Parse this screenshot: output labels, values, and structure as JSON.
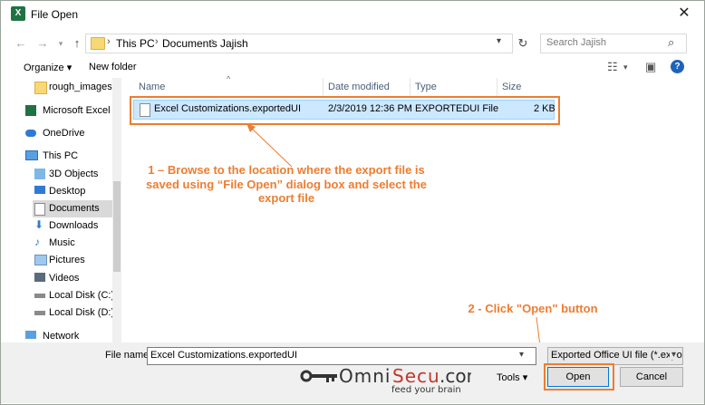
{
  "window": {
    "title": "File Open",
    "app_icon_letter": "X"
  },
  "address": {
    "crumbs": [
      "This PC",
      "Documents",
      "Jajish"
    ]
  },
  "search": {
    "placeholder": "Search Jajish"
  },
  "toolbar": {
    "organize": "Organize ▾",
    "new_folder": "New folder"
  },
  "sidebar": {
    "items": [
      {
        "label": "rough_images",
        "icon": "folder-icon"
      },
      {
        "label": "Microsoft Excel",
        "icon": "excel-icon"
      },
      {
        "label": "OneDrive",
        "icon": "cloud-icon"
      },
      {
        "label": "This PC",
        "icon": "computer-icon"
      },
      {
        "label": "3D Objects",
        "icon": "3d-objects-icon"
      },
      {
        "label": "Desktop",
        "icon": "desktop-icon"
      },
      {
        "label": "Documents",
        "icon": "documents-icon",
        "selected": true
      },
      {
        "label": "Downloads",
        "icon": "download-icon"
      },
      {
        "label": "Music",
        "icon": "music-icon"
      },
      {
        "label": "Pictures",
        "icon": "pictures-icon"
      },
      {
        "label": "Videos",
        "icon": "videos-icon"
      },
      {
        "label": "Local Disk (C:)",
        "icon": "drive-icon"
      },
      {
        "label": "Local Disk (D:)",
        "icon": "drive-icon"
      },
      {
        "label": "Network",
        "icon": "network-icon"
      }
    ]
  },
  "columns": {
    "name": "Name",
    "date": "Date modified",
    "type": "Type",
    "size": "Size"
  },
  "file": {
    "name": "Excel Customizations.exportedUI",
    "date": "2/3/2019 12:36 PM",
    "type": "EXPORTEDUI File",
    "size": "2 KB"
  },
  "annotations": {
    "step1_line1": "1 – Browse to the location where the export file is",
    "step1_line2": "saved using “File Open” dialog box and select the",
    "step1_line3": "export file",
    "step2": "2 - Click \"Open\" button"
  },
  "bottom": {
    "filename_label": "File name:",
    "filename_value": "Excel Customizations.exportedUI",
    "filetype_value": "Exported Office UI file (*.exportedUI)",
    "tools_label": "Tools ▾",
    "open_label": "Open",
    "cancel_label": "Cancel"
  },
  "logo": {
    "brand": "OmniSecu.com",
    "tagline": "feed your brain"
  },
  "colors": {
    "accent": "#ed7d31",
    "selection": "#cce8ff",
    "primary_border": "#0078d7"
  }
}
